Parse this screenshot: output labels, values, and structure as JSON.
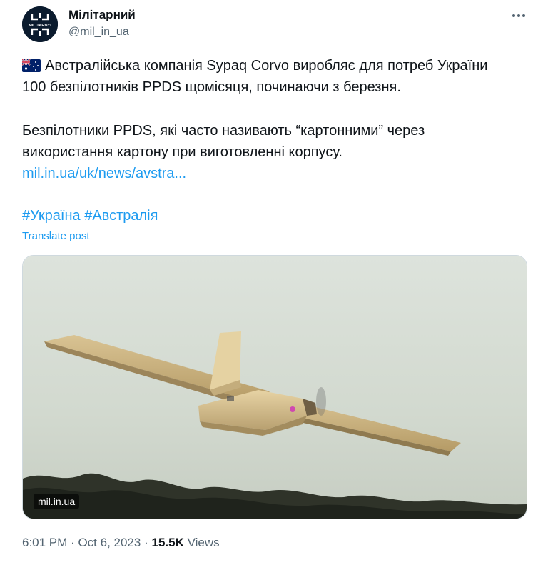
{
  "author": {
    "display_name": "Мілітарний",
    "handle": "@mil_in_ua",
    "avatar_icon": "militarnyi-logo-icon",
    "avatar_text": "MILITARNYI"
  },
  "more_icon": "more-dots-icon",
  "tweet": {
    "flag_icon": "australia-flag-icon",
    "line1": "Австралійська компанія Sypaq Corvo виробляє для потреб України",
    "line2": "100 безпілотників PPDS щомісяця, починаючи з березня.",
    "line3": "Безпілотники PPDS, які часто називають “картонними” через",
    "line4": "використання картону при виготовленні корпусу.",
    "link": "mil.in.ua/uk/news/avstra...",
    "hashtag1": "#Україна",
    "hashtag2": "#Австралія",
    "translate": "Translate post"
  },
  "media": {
    "badge": "mil.in.ua",
    "description_icon": "cardboard-drone-photo"
  },
  "meta": {
    "time": "6:01 PM",
    "sep1": "·",
    "date": "Oct 6, 2023",
    "sep2": "·",
    "views_count": "15.5K",
    "views_label": "Views"
  },
  "colors": {
    "link": "#1d9bf0",
    "secondary_text": "#536471",
    "primary_text": "#0f1419",
    "sky": "#d9e0d9"
  }
}
